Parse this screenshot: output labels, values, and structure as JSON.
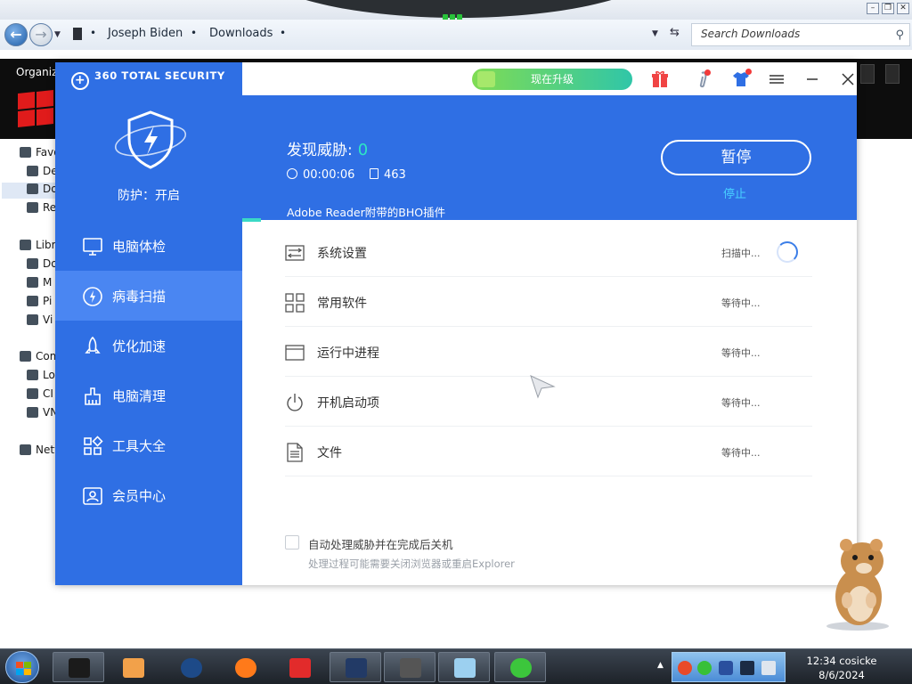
{
  "explorer": {
    "breadcrumbs": [
      "Joseph Biden",
      "Downloads"
    ],
    "search_placeholder": "Search Downloads",
    "organize_label": "Organize",
    "nav_items": [
      "Favo",
      "De",
      "Do",
      "Re",
      "Libr",
      "Do",
      "M",
      "Pi",
      "Vi",
      "Com",
      "Lo",
      "CI",
      "VN",
      "Netw"
    ]
  },
  "app": {
    "brand": "360 TOTAL SECURITY",
    "upgrade_label": "现在升级",
    "protection_status": "防护：开启",
    "sidebar": [
      {
        "label": "电脑体检",
        "icon": "monitor-icon"
      },
      {
        "label": "病毒扫描",
        "icon": "virus-scan-icon",
        "active": true
      },
      {
        "label": "优化加速",
        "icon": "rocket-icon"
      },
      {
        "label": "电脑清理",
        "icon": "broom-icon"
      },
      {
        "label": "工具大全",
        "icon": "tools-icon"
      },
      {
        "label": "会员中心",
        "icon": "member-icon"
      }
    ],
    "scan": {
      "found_label": "发现威胁:",
      "found_count": "0",
      "elapsed": "00:00:06",
      "files_scanned": "463",
      "current_item": "Adobe Reader附带的BHO插件",
      "pause_label": "暂停",
      "stop_label": "停止",
      "progress": 0.03
    },
    "scan_items": [
      {
        "label": "系统设置",
        "status": "扫描中...",
        "icon": "settings-sliders-icon"
      },
      {
        "label": "常用软件",
        "status": "等待中...",
        "icon": "apps-grid-icon"
      },
      {
        "label": "运行中进程",
        "status": "等待中...",
        "icon": "window-icon"
      },
      {
        "label": "开机启动项",
        "status": "等待中...",
        "icon": "power-icon"
      },
      {
        "label": "文件",
        "status": "等待中...",
        "icon": "file-icon"
      }
    ],
    "auto_handle_label": "自动处理威胁并在完成后关机",
    "auto_handle_note": "处理过程可能需要关闭浏览器或重启Explorer"
  },
  "taskbar": {
    "time": "12:34 cosicke",
    "date": "8/6/2024"
  },
  "colors": {
    "brand_blue": "#2f6fe4",
    "active_blue": "#4a86f2",
    "threat_count": "#2ee6c4",
    "stop_link": "#48d0ff",
    "upgrade_start": "#7fdc53",
    "upgrade_end": "#30c6a8"
  }
}
